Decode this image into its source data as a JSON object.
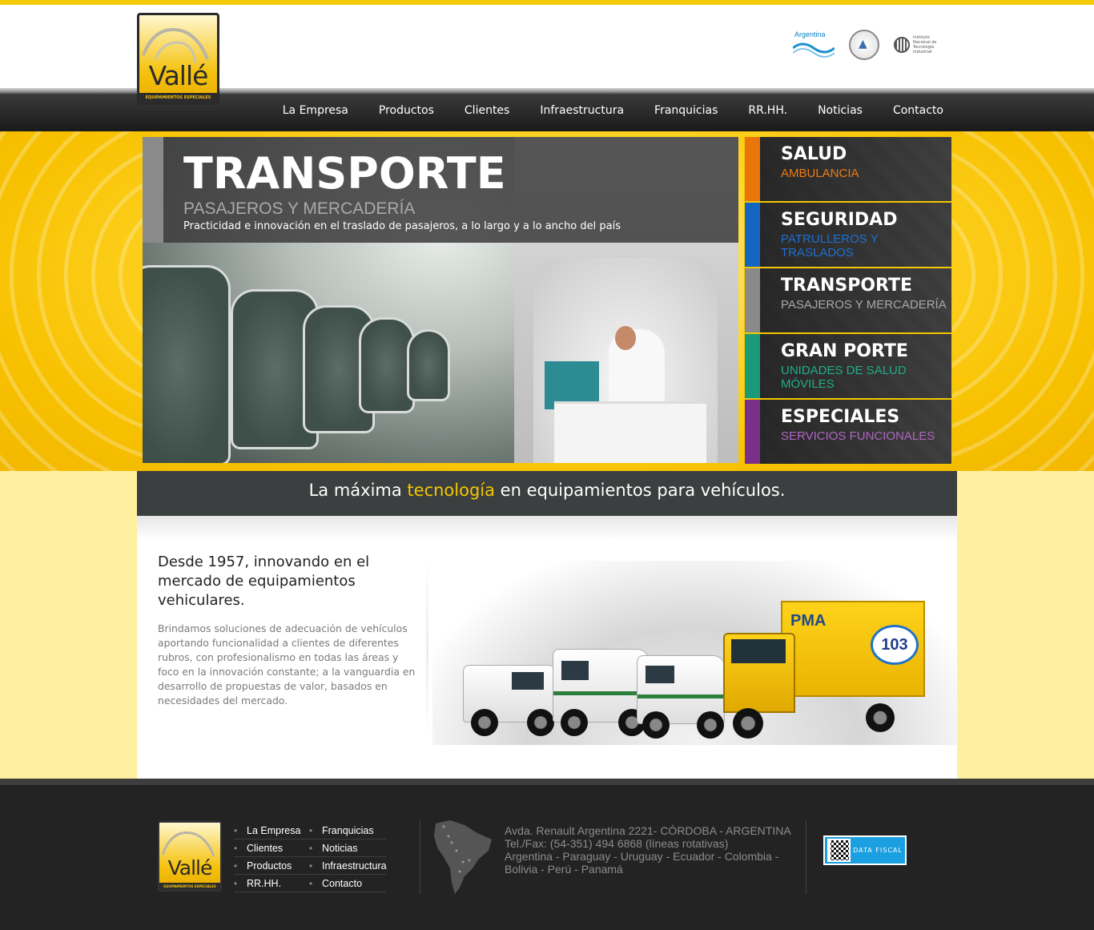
{
  "brand": {
    "logo_text": "Vallé",
    "logo_sub": "EQUIPAMIENTOS ESPECIALES"
  },
  "certs": {
    "argentina_label": "Argentina",
    "inti_label": "Instituto Nacional de Tecnología Industrial",
    "inti_short": "INTI"
  },
  "nav": [
    {
      "label": "La Empresa"
    },
    {
      "label": "Productos"
    },
    {
      "label": "Clientes"
    },
    {
      "label": "Infraestructura"
    },
    {
      "label": "Franquicias"
    },
    {
      "label": "RR.HH."
    },
    {
      "label": "Noticias"
    },
    {
      "label": "Contacto"
    }
  ],
  "slide": {
    "title": "TRANSPORTE",
    "subtitle": "PASAJEROS Y MERCADERÍA",
    "description": "Practicidad e innovación en el traslado de pasajeros, a lo largo y a lo ancho del país"
  },
  "categories": [
    {
      "title": "SALUD",
      "subtitle": "AMBULANCIA",
      "stripe_color": "#e8760b",
      "sub_color": "#f07a10"
    },
    {
      "title": "SEGURIDAD",
      "subtitle": "PATRULLEROS Y TRASLADOS",
      "stripe_color": "#1565c0",
      "sub_color": "#1e6fd0"
    },
    {
      "title": "TRANSPORTE",
      "subtitle": "PASAJEROS Y MERCADERÍA",
      "stripe_color": "#8a8a8a",
      "sub_color": "#a8a8a8"
    },
    {
      "title": "GRAN PORTE",
      "subtitle": "UNIDADES DE SALUD MÓVILES",
      "stripe_color": "#1a9a78",
      "sub_color": "#1fae86"
    },
    {
      "title": "ESPECIALES",
      "subtitle": "SERVICIOS FUNCIONALES",
      "stripe_color": "#7a2f8a",
      "sub_color": "#b066c4"
    }
  ],
  "tagline": {
    "before": "La máxima ",
    "highlight": "tecnología",
    "after": " en equipamientos para vehículos."
  },
  "about": {
    "heading": "Desde 1957, innovando en el mercado de equipamientos vehiculares.",
    "body": "Brindamos soluciones de adecuación de vehículos aportando funcionalidad a clientes de diferentes rubros, con profesionalismo en todas las áreas y foco en la innovación constante; a la vanguardia en desarrollo de propuestas de valor, basados en necesidades del mercado."
  },
  "fleet": {
    "truck_label": "PMA",
    "truck_number": "103"
  },
  "footer": {
    "links": [
      "La Empresa",
      "Franquicias",
      "Clientes",
      "Noticias",
      "Productos",
      "Infraestructura",
      "RR.HH.",
      "Contacto"
    ],
    "address": "Avda. Renault Argentina 2221- CÓRDOBA - ARGENTINA",
    "phone": "Tel./Fax: (54-351) 494 6868 (líneas rotativas)",
    "countries": "Argentina - Paraguay - Uruguay - Ecuador - Colombia - Bolivia - Perú - Panamá",
    "data_fiscal": "DATA FISCAL"
  }
}
